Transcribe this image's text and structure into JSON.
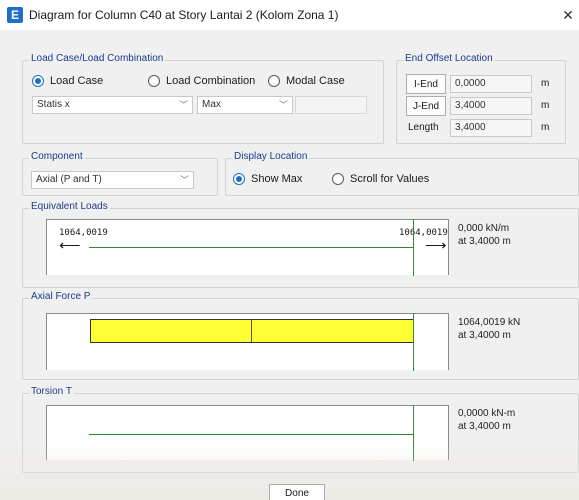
{
  "window": {
    "icon_letter": "E",
    "title": "Diagram for Column C40 at Story Lantai 2 (Kolom Zona 1)",
    "close_symbol": "✕"
  },
  "load_case_group": {
    "label": "Load Case/Load Combination",
    "options": [
      {
        "label": "Load Case",
        "checked": true
      },
      {
        "label": "Load Combination",
        "checked": false
      },
      {
        "label": "Modal Case",
        "checked": false
      }
    ],
    "case_select": "Statis x",
    "type_select": "Max",
    "extra_field": ""
  },
  "end_offset": {
    "label": "End Offset Location",
    "rows": [
      {
        "button": "I-End",
        "value": "0,0000",
        "unit": "m"
      },
      {
        "button": "J-End",
        "value": "3,4000",
        "unit": "m"
      },
      {
        "label": "Length",
        "value": "3,4000",
        "unit": "m"
      }
    ]
  },
  "component": {
    "label": "Component",
    "select": "Axial (P and T)"
  },
  "display_location": {
    "label": "Display Location",
    "options": [
      {
        "label": "Show Max",
        "checked": true
      },
      {
        "label": "Scroll for Values",
        "checked": false
      }
    ]
  },
  "equivalent_loads": {
    "label": "Equivalent Loads",
    "left_value": "1064,0019",
    "right_value": "1064,0019",
    "readout_line1": "0,000 kN/m",
    "readout_line2": "at 3,4000 m"
  },
  "axial_force": {
    "label": "Axial Force P",
    "readout_line1": "1064,0019 kN",
    "readout_line2": "at 3,4000 m",
    "fill_color": "#ffff33"
  },
  "torsion": {
    "label": "Torsion T",
    "readout_line1": "0,0000 kN-m",
    "readout_line2": "at 3,4000 m"
  },
  "done_label": "Done",
  "colors": {
    "accent": "#1e6fc8",
    "group_label": "#1b3c8a",
    "diagram_line": "#2e8b2e"
  }
}
